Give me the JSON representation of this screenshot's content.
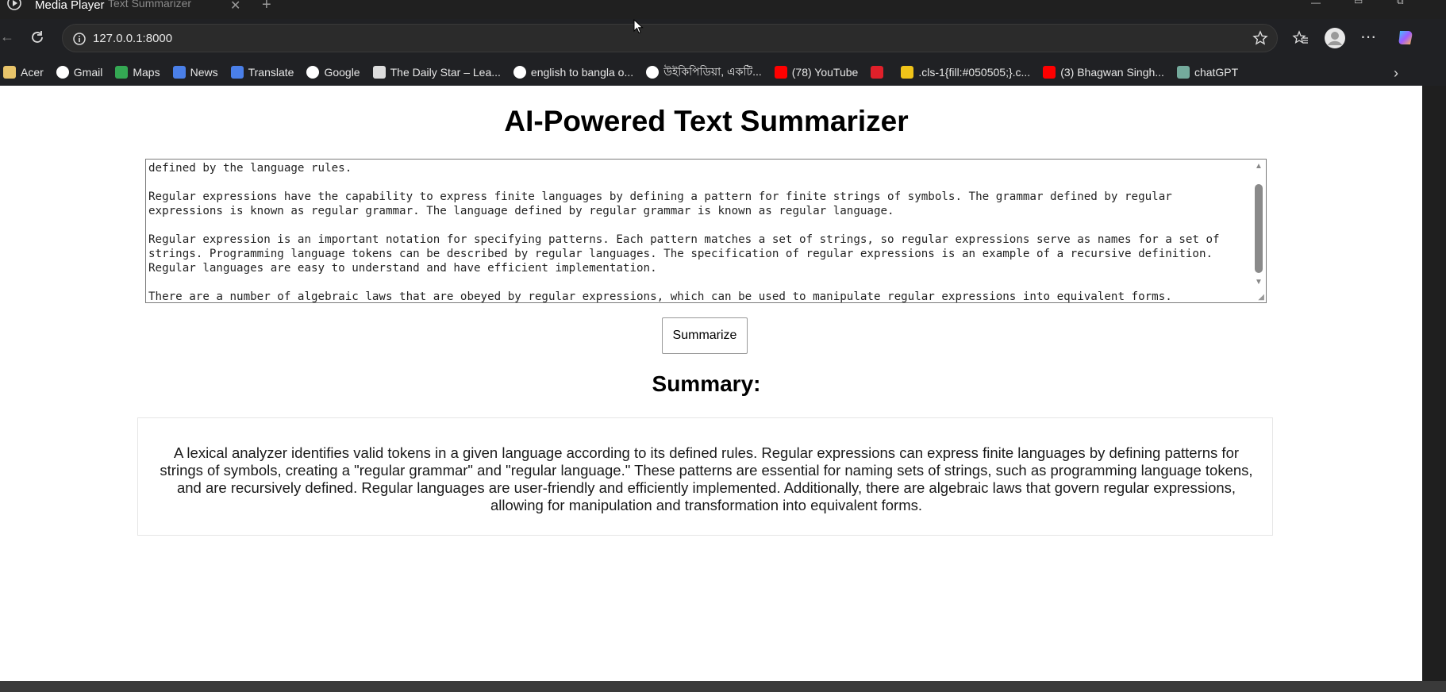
{
  "window": {
    "player_title": "Media Player",
    "tab_title": "Text Summarizer"
  },
  "browser": {
    "url": "127.0.0.1:8000",
    "bookmarks": [
      {
        "label": "Acer",
        "icon": "folder-icon",
        "color": "#e8c46a"
      },
      {
        "label": "Gmail",
        "icon": "google-icon",
        "color": "#ffffff"
      },
      {
        "label": "Maps",
        "icon": "maps-icon",
        "color": "#34a853"
      },
      {
        "label": "News",
        "icon": "news-icon",
        "color": "#4a7fe8"
      },
      {
        "label": "Translate",
        "icon": "translate-icon",
        "color": "#4a7fe8"
      },
      {
        "label": "Google",
        "icon": "google-icon",
        "color": "#ffffff"
      },
      {
        "label": "The Daily Star – Lea...",
        "icon": "daily-star-icon",
        "color": "#dddddd"
      },
      {
        "label": "english to bangla o...",
        "icon": "google-icon",
        "color": "#ffffff"
      },
      {
        "label": "উইকিপিডিয়া, একটি...",
        "icon": "wikipedia-icon",
        "color": "#ffffff"
      },
      {
        "label": "(78) YouTube",
        "icon": "youtube-icon",
        "color": "#ff0000"
      },
      {
        "label": "",
        "icon": "refresh-red-icon",
        "color": "#e0202a"
      },
      {
        "label": ".cls-1{fill:#050505;}.c...",
        "icon": "diamond-icon",
        "color": "#f0c419"
      },
      {
        "label": "(3) Bhagwan Singh...",
        "icon": "youtube-icon",
        "color": "#ff0000"
      },
      {
        "label": "chatGPT",
        "icon": "chatgpt-icon",
        "color": "#74aa9c"
      }
    ]
  },
  "page": {
    "title": "AI-Powered Text Summarizer",
    "input_text": "defined by the language rules.\n\nRegular expressions have the capability to express finite languages by defining a pattern for finite strings of symbols. The grammar defined by regular\nexpressions is known as regular grammar. The language defined by regular grammar is known as regular language.\n\nRegular expression is an important notation for specifying patterns. Each pattern matches a set of strings, so regular expressions serve as names for a set of\nstrings. Programming language tokens can be described by regular languages. The specification of regular expressions is an example of a recursive definition.\nRegular languages are easy to understand and have efficient implementation.\n\nThere are a number of algebraic laws that are obeyed by regular expressions, which can be used to manipulate regular expressions into equivalent forms.",
    "button_label": "Summarize",
    "summary_heading": "Summary:",
    "summary_text": "A lexical analyzer identifies valid tokens in a given language according to its defined rules. Regular expressions can express finite languages by defining patterns for strings of symbols, creating a \"regular grammar\" and \"regular language.\" These patterns are essential for naming sets of strings, such as programming language tokens, and are recursively defined. Regular languages are user-friendly and efficiently implemented. Additionally, there are algebraic laws that govern regular expressions, allowing for manipulation and transformation into equivalent forms."
  }
}
